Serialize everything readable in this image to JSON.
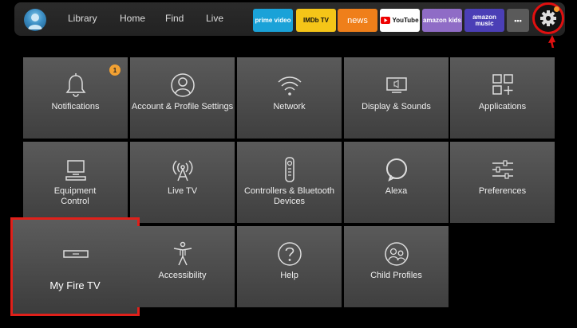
{
  "nav": {
    "items": [
      "Library",
      "Home",
      "Find",
      "Live"
    ]
  },
  "apps": [
    {
      "label": "prime video",
      "bg": "#1aa2d8",
      "fg": "#ffffff"
    },
    {
      "label": "IMDb TV",
      "bg": "#f5c518",
      "fg": "#111111"
    },
    {
      "label": "news",
      "bg": "#ef7f1a",
      "fg": "#ffffff"
    },
    {
      "label": "YouTube",
      "bg": "#ffffff",
      "fg": "#111111"
    },
    {
      "label": "amazon kids",
      "bg": "#8f6cc6",
      "fg": "#ffffff"
    },
    {
      "label": "amazon music",
      "bg": "#4b3fb6",
      "fg": "#ffffff"
    },
    {
      "label": "•••",
      "bg": "#5a5a5a",
      "fg": "#ffffff"
    }
  ],
  "tiles": [
    {
      "label": "Notifications",
      "icon": "bell-icon",
      "badge": "1"
    },
    {
      "label": "Account & Profile Settings",
      "icon": "user-icon"
    },
    {
      "label": "Network",
      "icon": "wifi-icon"
    },
    {
      "label": "Display & Sounds",
      "icon": "monitor-icon"
    },
    {
      "label": "Applications",
      "icon": "apps-grid-icon"
    },
    {
      "label": "Equipment Control",
      "icon": "tv-icon"
    },
    {
      "label": "Live TV",
      "icon": "antenna-icon"
    },
    {
      "label": "Controllers & Bluetooth Devices",
      "icon": "remote-icon"
    },
    {
      "label": "Alexa",
      "icon": "alexa-icon"
    },
    {
      "label": "Preferences",
      "icon": "sliders-icon"
    },
    {
      "label": "My Fire TV",
      "icon": "fire-tv-device-icon",
      "focused": true
    },
    {
      "label": "Accessibility",
      "icon": "accessibility-icon"
    },
    {
      "label": "Help",
      "icon": "help-icon"
    },
    {
      "label": "Child Profiles",
      "icon": "child-profiles-icon"
    }
  ]
}
